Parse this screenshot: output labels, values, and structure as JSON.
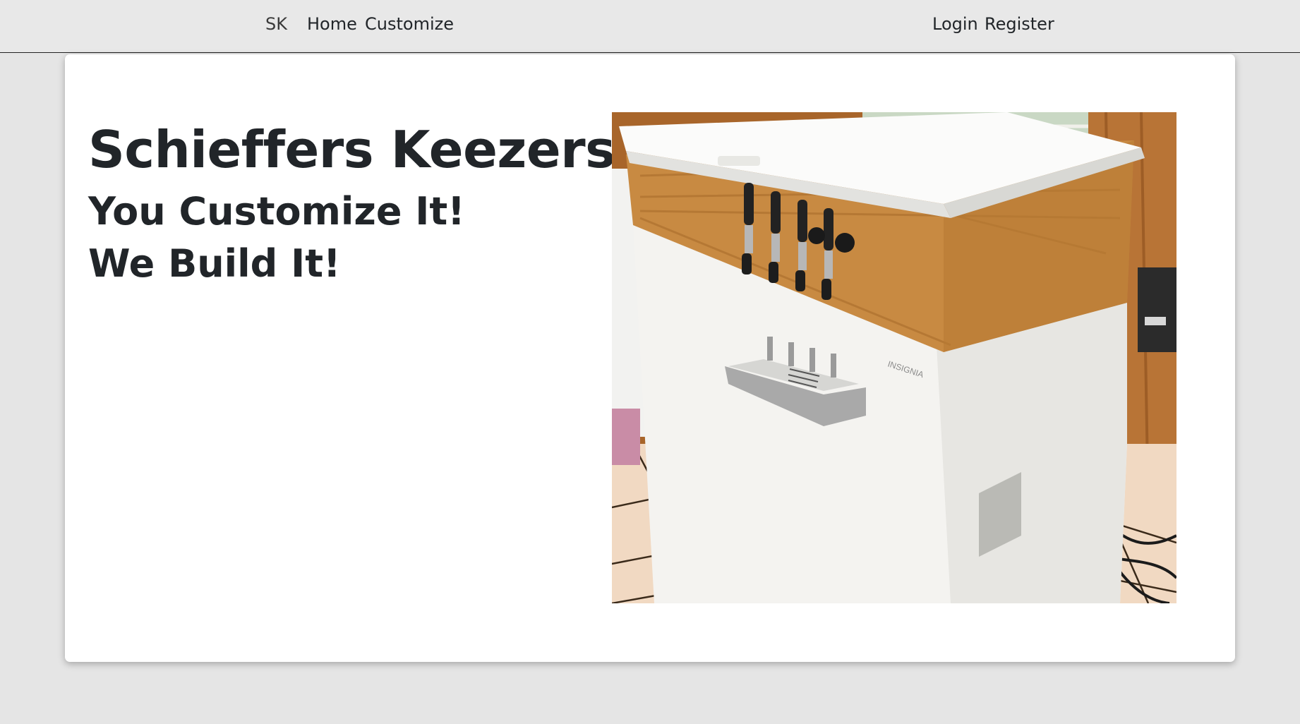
{
  "nav": {
    "brand": "SK",
    "home": "Home",
    "customize": "Customize",
    "login": "Login",
    "register": "Register"
  },
  "hero": {
    "title": "Schieffers Keezers",
    "line1": "You Customize It!",
    "line2": "We Build It!",
    "photo_brand_text": "INSIGNIA"
  }
}
